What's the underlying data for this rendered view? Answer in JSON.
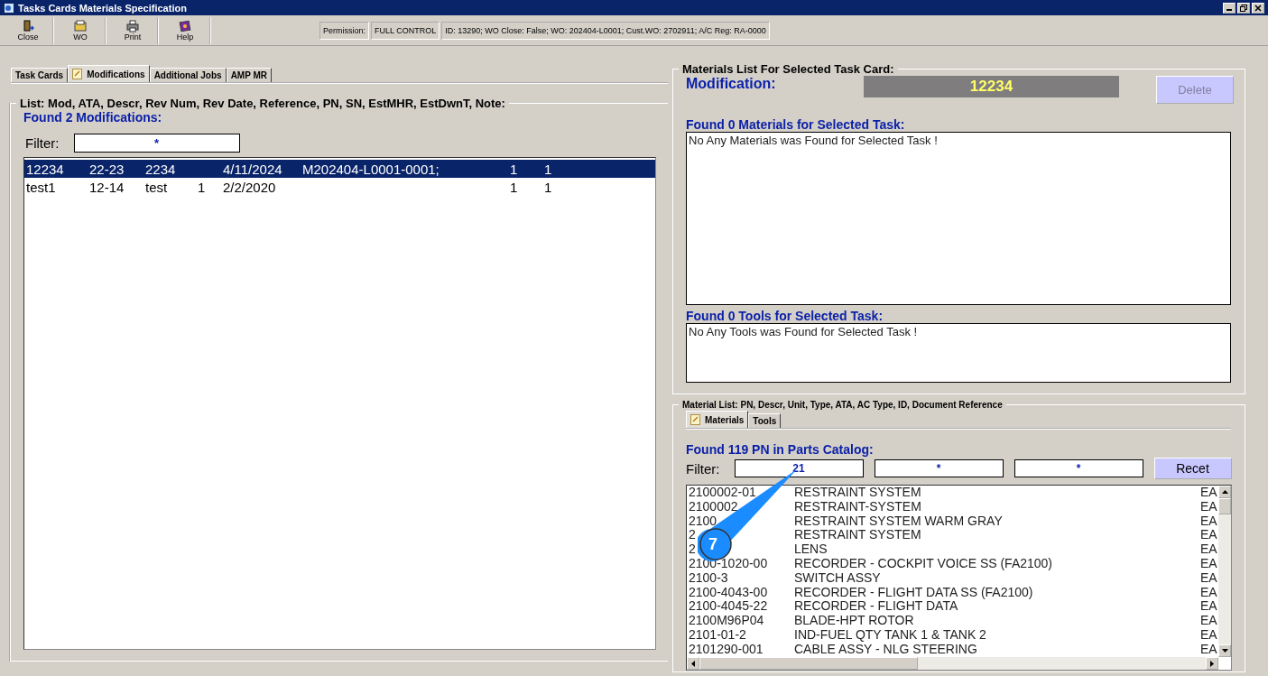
{
  "window": {
    "title": "Tasks Cards Materials Specification"
  },
  "toolbar": [
    {
      "label": "Close",
      "kind": "close"
    },
    {
      "label": "WO",
      "kind": "wo"
    },
    {
      "label": "Print",
      "kind": "print"
    },
    {
      "label": "Help",
      "kind": "help"
    }
  ],
  "info": {
    "permission_label": "Permission:",
    "permission": "FULL CONTROL",
    "details": "ID: 13290; WO Close: False; WO: 202404-L0001; Cust.WO: 2702911; A/C Reg: RA-0000"
  },
  "tabs": [
    {
      "label": "Task Cards",
      "selected": false,
      "icon": false
    },
    {
      "label": "Modifications",
      "selected": true,
      "icon": true
    },
    {
      "label": "Additional Jobs",
      "selected": false,
      "icon": false
    },
    {
      "label": "AMP MR",
      "selected": false,
      "icon": false
    }
  ],
  "modifications": {
    "legend": "List: Mod, ATA, Descr, Rev Num, Rev Date, Reference, PN, SN, EstMHR, EstDwnT, Note:",
    "found": "Found 2 Modifications:",
    "filter_label": "Filter:",
    "filter_value": "*",
    "rows": [
      {
        "cells": [
          "12234",
          "22-23",
          "2234",
          "",
          "4/11/2024",
          "M202404-L0001-0001;",
          "1",
          "1"
        ],
        "selected": true
      },
      {
        "cells": [
          "test1",
          "12-14",
          "test",
          "1",
          "2/2/2020",
          "",
          "1",
          "1"
        ],
        "selected": false
      }
    ]
  },
  "materials_panel": {
    "legend": "Materials List For Selected Task Card:",
    "mod_label": "Modification:",
    "mod_value": "12234",
    "delete_button": {
      "label": "Delete",
      "disabled": true
    },
    "materials_found": "Found 0 Materials for Selected Task:",
    "materials_message": "No Any Materials was Found for Selected Task !",
    "tools_found": "Found 0 Tools for Selected Task:",
    "tools_message": "No Any Tools was Found for Selected Task !"
  },
  "catalog": {
    "legend": "Material List: PN, Descr, Unit, Type, ATA, AC Type, ID, Document Reference",
    "tabs": [
      {
        "label": "Materials",
        "selected": true,
        "icon": true
      },
      {
        "label": "Tools",
        "selected": false,
        "icon": false
      }
    ],
    "found": "Found 119 PN in Parts Catalog:",
    "filter_label": "Filter:",
    "filters": [
      "21",
      "*",
      "*"
    ],
    "reset_button": "Recet",
    "rows": [
      {
        "pn": "2100002-01",
        "descr": "RESTRAINT SYSTEM",
        "unit": "EA"
      },
      {
        "pn": "2100002",
        "descr": "RESTRAINT-SYSTEM",
        "unit": "EA"
      },
      {
        "pn": "2100",
        "descr": "RESTRAINT SYSTEM WARM GRAY",
        "unit": "EA"
      },
      {
        "pn": "2",
        "descr": "RESTRAINT SYSTEM",
        "unit": "EA"
      },
      {
        "pn": "2",
        "descr": "LENS",
        "unit": "EA"
      },
      {
        "pn": "2100-1020-00",
        "descr": "RECORDER - COCKPIT VOICE SS (FA2100)",
        "unit": "EA"
      },
      {
        "pn": "2100-3",
        "descr": "SWITCH ASSY",
        "unit": "EA"
      },
      {
        "pn": "2100-4043-00",
        "descr": "RECORDER - FLIGHT DATA SS (FA2100)",
        "unit": "EA"
      },
      {
        "pn": "2100-4045-22",
        "descr": "RECORDER - FLIGHT DATA",
        "unit": "EA"
      },
      {
        "pn": "2100M96P04",
        "descr": "BLADE-HPT ROTOR",
        "unit": "EA"
      },
      {
        "pn": "2101-01-2",
        "descr": "IND-FUEL QTY TANK 1 & TANK 2",
        "unit": "EA"
      },
      {
        "pn": "2101290-001",
        "descr": "CABLE ASSY - NLG STEERING",
        "unit": "EA"
      }
    ]
  },
  "callout": {
    "label": "7"
  }
}
